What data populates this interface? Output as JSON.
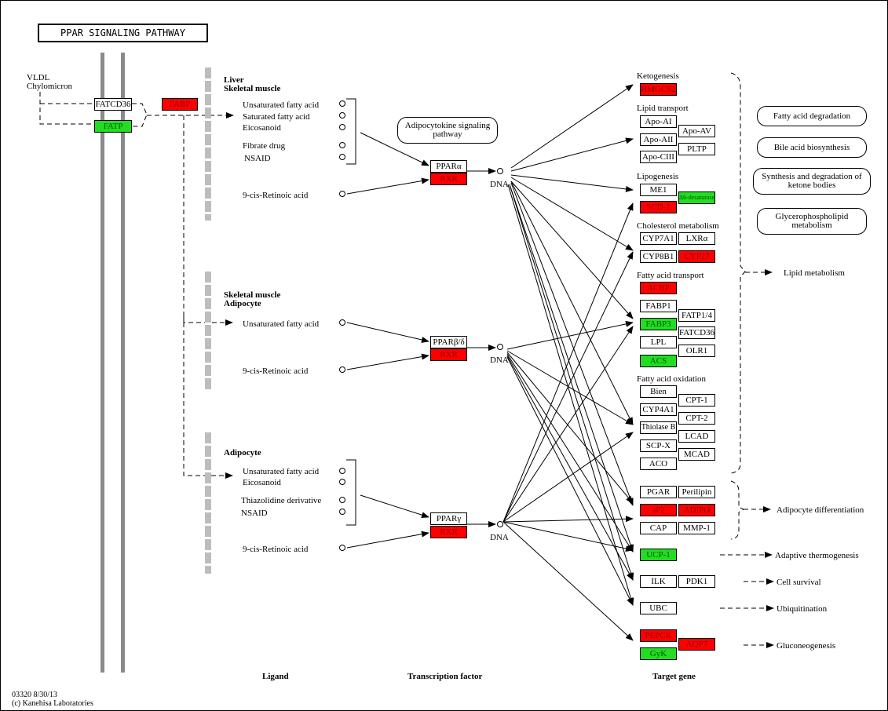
{
  "title": "PPAR SIGNALING PATHWAY",
  "colors": {
    "up": "#ff0000",
    "down": "#22dd22",
    "neutral": "#ffffff"
  },
  "membrane": {
    "source_labels": [
      "VLDL",
      "Chylomicron"
    ],
    "genes": [
      {
        "label": "FATCD36",
        "state": "neutral"
      },
      {
        "label": "FATP",
        "state": "down"
      },
      {
        "label": "FABP",
        "state": "up"
      }
    ]
  },
  "sections": [
    {
      "tissue": [
        "Liver",
        "Skeletal muscle"
      ],
      "ligands": [
        "Unsaturated fatty acid",
        "Saturated fatty acid",
        "Eicosanoid",
        "Fibrate drug",
        "NSAID"
      ],
      "retinoic": "9-cis-Retinoic acid",
      "factor": "PPARα",
      "partner": "RXR",
      "dna": "DNA"
    },
    {
      "tissue": [
        "Skeletal muscle",
        "Adipocyte"
      ],
      "ligands": [
        "Unsaturated fatty acid"
      ],
      "retinoic": "9-cis-Retinoic acid",
      "factor": "PPARβ/δ",
      "partner": "RXR",
      "dna": "DNA"
    },
    {
      "tissue": [
        "Adipocyte"
      ],
      "ligands": [
        "Unsaturated fatty acid",
        "Eicosanoid",
        "Thiazolidine derivative",
        "NSAID"
      ],
      "retinoic": "9-cis-Retinoic acid",
      "factor": "PPARγ",
      "partner": "RXR",
      "dna": "DNA"
    }
  ],
  "adipocytokine_link": "Adipocytokine signaling pathway",
  "target_groups": {
    "ketogenesis": {
      "label": "Ketogenesis",
      "genes": [
        {
          "label": "HMGCS2",
          "state": "up"
        }
      ]
    },
    "lipid_transport": {
      "label": "Lipid transport",
      "genes": [
        {
          "label": "Apo-AI",
          "state": "neutral"
        },
        {
          "label": "Apo-AII",
          "state": "neutral"
        },
        {
          "label": "Apo-CIII",
          "state": "neutral"
        },
        {
          "label": "Apo-AV",
          "state": "neutral"
        },
        {
          "label": "PLTP",
          "state": "neutral"
        }
      ]
    },
    "lipogenesis": {
      "label": "Lipogenesis",
      "genes": [
        {
          "label": "ME1",
          "state": "neutral"
        },
        {
          "label": "SCD-1",
          "state": "up"
        },
        {
          "label": "Δ6-desaturase",
          "state": "down"
        }
      ]
    },
    "cholesterol": {
      "label": "Cholesterol metabolism",
      "genes": [
        {
          "label": "CYP7A1",
          "state": "neutral"
        },
        {
          "label": "CYP8B1",
          "state": "neutral"
        },
        {
          "label": "LXRα",
          "state": "neutral"
        },
        {
          "label": "CYP27",
          "state": "up"
        }
      ]
    },
    "fa_transport": {
      "label": "Fatty acid transport",
      "genes": [
        {
          "label": "ACBP",
          "state": "up"
        },
        {
          "label": "FABP1",
          "state": "neutral"
        },
        {
          "label": "FABP3",
          "state": "down"
        },
        {
          "label": "LPL",
          "state": "neutral"
        },
        {
          "label": "ACS",
          "state": "down"
        },
        {
          "label": "FATP1/4",
          "state": "neutral"
        },
        {
          "label": "FATCD36",
          "state": "neutral"
        },
        {
          "label": "OLR1",
          "state": "neutral"
        }
      ]
    },
    "fa_oxidation": {
      "label": "Fatty acid oxidation",
      "genes": [
        {
          "label": "Bien",
          "state": "neutral"
        },
        {
          "label": "CYP4A1",
          "state": "neutral"
        },
        {
          "label": "Thiolase B",
          "state": "neutral"
        },
        {
          "label": "SCP-X",
          "state": "neutral"
        },
        {
          "label": "ACO",
          "state": "neutral"
        },
        {
          "label": "CPT-1",
          "state": "neutral"
        },
        {
          "label": "CPT-2",
          "state": "neutral"
        },
        {
          "label": "LCAD",
          "state": "neutral"
        },
        {
          "label": "MCAD",
          "state": "neutral"
        }
      ]
    },
    "adipocyte": {
      "label": "",
      "genes": [
        {
          "label": "PGAR",
          "state": "neutral"
        },
        {
          "label": "aP2",
          "state": "up"
        },
        {
          "label": "CAP",
          "state": "neutral"
        },
        {
          "label": "Perilipin",
          "state": "neutral"
        },
        {
          "label": "ADIPO",
          "state": "up"
        },
        {
          "label": "MMP-1",
          "state": "neutral"
        }
      ]
    },
    "misc": {
      "label": "",
      "genes": [
        {
          "label": "UCP-1",
          "state": "down"
        },
        {
          "label": "ILK",
          "state": "neutral"
        },
        {
          "label": "PDK1",
          "state": "neutral"
        },
        {
          "label": "UBC",
          "state": "neutral"
        },
        {
          "label": "PEPCK",
          "state": "up"
        },
        {
          "label": "GyK",
          "state": "down"
        },
        {
          "label": "AQP7",
          "state": "up"
        }
      ]
    }
  },
  "pathway_links": [
    "Fatty acid degradation",
    "Bile acid biosynthesis",
    "Synthesis and degradation of ketone bodies",
    "Glycerophospholipid metabolism"
  ],
  "outcomes": [
    "Lipid metabolism",
    "Adipocyte differentiation",
    "Adaptive thermogenesis",
    "Cell survival",
    "Ubiquitination",
    "Gluconeogenesis"
  ],
  "columns": {
    "ligand": "Ligand",
    "factor": "Transcription factor",
    "target": "Target gene"
  },
  "footer": {
    "id_date": "03320 8/30/13",
    "copyright": "(c) Kanehisa Laboratories"
  }
}
